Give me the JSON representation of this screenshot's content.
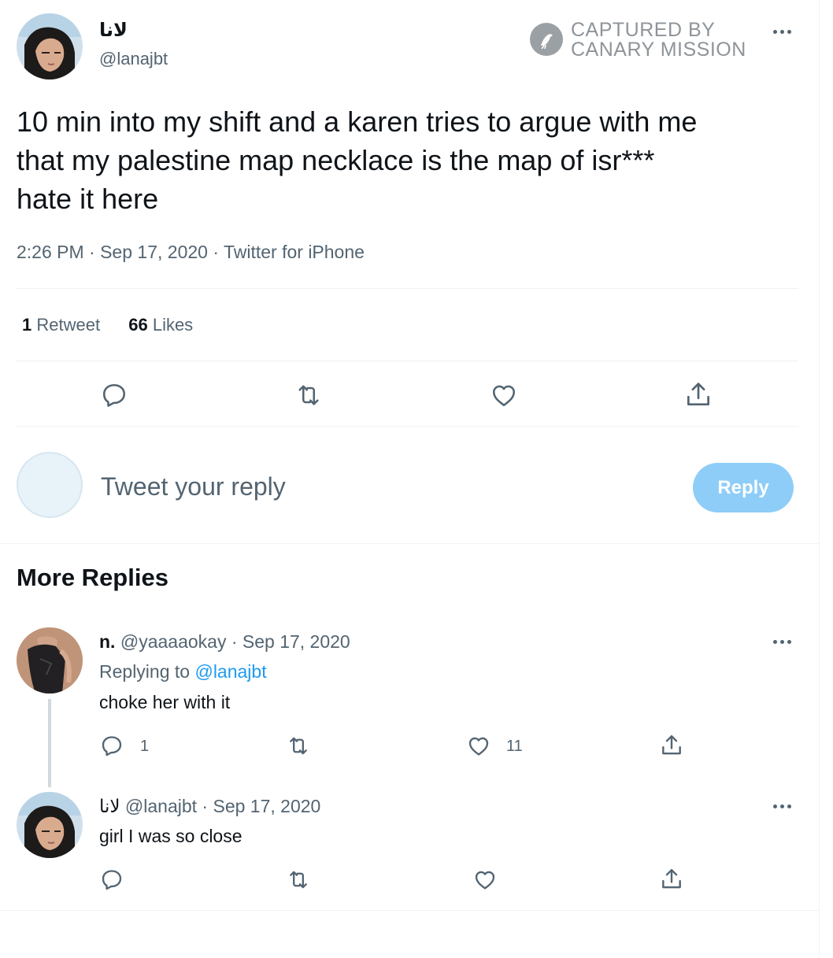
{
  "tweet": {
    "display_name": "لانا",
    "handle": "@lanajbt",
    "text_lines": [
      "10 min into my shift and a karen tries to argue with me",
      "that my palestine map necklace is the map of isr***",
      "hate it here"
    ],
    "meta": "2:26 PM · Sep 17, 2020 · Twitter for iPhone",
    "retweets_count": "1",
    "retweets_label": "Retweet",
    "likes_count": "66",
    "likes_label": "Likes",
    "icons": [
      "reply-icon",
      "retweet-icon",
      "like-icon",
      "share-icon",
      "more-icon"
    ]
  },
  "watermark": {
    "line1": "CAPTURED BY",
    "line2": "CANARY MISSION",
    "icon": "canary-bird-icon"
  },
  "compose": {
    "placeholder": "Tweet your reply",
    "reply_button": "Reply",
    "reply_button_color": "#8ecdf8"
  },
  "more_replies": {
    "heading": "More Replies"
  },
  "replies": [
    {
      "name": "n.",
      "handle_date": "@yaaaaokay · Sep 17, 2020",
      "replying_prefix": "Replying to",
      "replying_to": "@lanajbt",
      "text": "choke her with it",
      "reply_count": "1",
      "like_count": "11"
    },
    {
      "name": "لانا",
      "handle_date": "@lanajbt · Sep 17, 2020",
      "text": "girl I was so close"
    }
  ],
  "colors": {
    "text": "#0f1419",
    "muted": "#536471",
    "link": "#1d9bf0",
    "divider": "#eff3f4"
  }
}
